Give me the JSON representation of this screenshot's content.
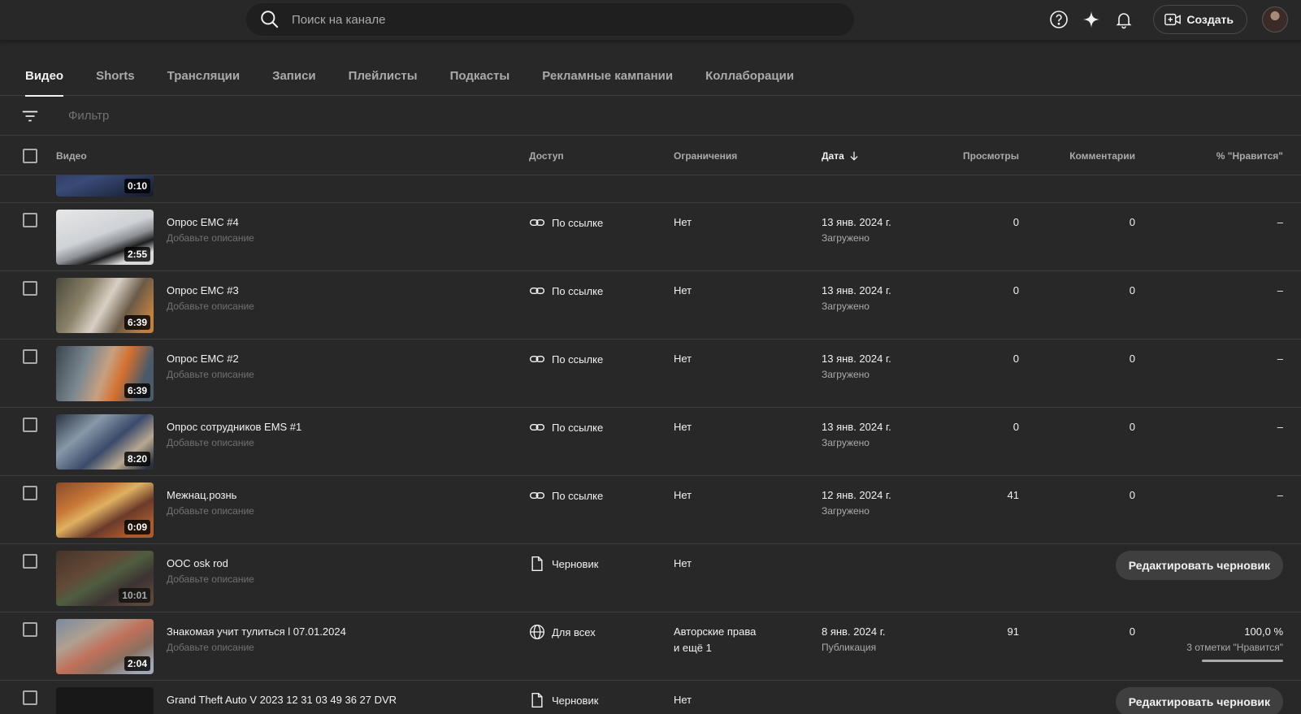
{
  "search": {
    "placeholder": "Поиск на канале"
  },
  "topbar": {
    "create_label": "Создать"
  },
  "tabs": [
    {
      "label": "Видео",
      "active": true
    },
    {
      "label": "Shorts"
    },
    {
      "label": "Трансляции"
    },
    {
      "label": "Записи"
    },
    {
      "label": "Плейлисты"
    },
    {
      "label": "Подкасты"
    },
    {
      "label": "Рекламные кампании"
    },
    {
      "label": "Коллаборации"
    }
  ],
  "filter": {
    "placeholder": "Фильтр"
  },
  "columns": {
    "video": "Видео",
    "visibility": "Доступ",
    "restrictions": "Ограничения",
    "date": "Дата",
    "views": "Просмотры",
    "comments": "Комментарии",
    "likes": "% \"Нравится\""
  },
  "partial_row": {
    "duration": "0:10"
  },
  "rows": [
    {
      "title": "Опрос EMC #4",
      "description": "Добавьте описание",
      "duration": "2:55",
      "visibility": "По ссылке",
      "visibility_icon": "link-icon",
      "restrictions": "Нет",
      "restrictions_2": "",
      "date": "13 янв. 2024 г.",
      "status": "Загружено",
      "views": "0",
      "comments": "0",
      "likes": "–",
      "likes_sub": "",
      "draft_label": ""
    },
    {
      "title": "Опрос EMC #3",
      "description": "Добавьте описание",
      "duration": "6:39",
      "visibility": "По ссылке",
      "visibility_icon": "link-icon",
      "restrictions": "Нет",
      "restrictions_2": "",
      "date": "13 янв. 2024 г.",
      "status": "Загружено",
      "views": "0",
      "comments": "0",
      "likes": "–",
      "likes_sub": "",
      "draft_label": ""
    },
    {
      "title": "Опрос EMC #2",
      "description": "Добавьте описание",
      "duration": "6:39",
      "visibility": "По ссылке",
      "visibility_icon": "link-icon",
      "restrictions": "Нет",
      "restrictions_2": "",
      "date": "13 янв. 2024 г.",
      "status": "Загружено",
      "views": "0",
      "comments": "0",
      "likes": "–",
      "likes_sub": "",
      "draft_label": ""
    },
    {
      "title": "Опрос сотрудников EMS #1",
      "description": "Добавьте описание",
      "duration": "8:20",
      "visibility": "По ссылке",
      "visibility_icon": "link-icon",
      "restrictions": "Нет",
      "restrictions_2": "",
      "date": "13 янв. 2024 г.",
      "status": "Загружено",
      "views": "0",
      "comments": "0",
      "likes": "–",
      "likes_sub": "",
      "draft_label": ""
    },
    {
      "title": "Межнац.рознь",
      "description": "Добавьте описание",
      "duration": "0:09",
      "visibility": "По ссылке",
      "visibility_icon": "link-icon",
      "restrictions": "Нет",
      "restrictions_2": "",
      "date": "12 янв. 2024 г.",
      "status": "Загружено",
      "views": "41",
      "comments": "0",
      "likes": "–",
      "likes_sub": "",
      "draft_label": ""
    },
    {
      "title": "OOC osk rod",
      "description": "Добавьте описание",
      "duration": "10:01",
      "visibility": "Черновик",
      "visibility_icon": "draft-icon",
      "restrictions": "Нет",
      "restrictions_2": "",
      "date": "",
      "status": "",
      "views": "",
      "comments": "",
      "likes": "",
      "likes_sub": "",
      "draft_label": "Редактировать черновик"
    },
    {
      "title": "Знакомая учит тулиться l 07.01.2024",
      "description": "Добавьте описание",
      "duration": "2:04",
      "visibility": "Для всех",
      "visibility_icon": "globe-icon",
      "restrictions": "Авторские права",
      "restrictions_2": "и ещё 1",
      "date": "8 янв. 2024 г.",
      "status": "Публикация",
      "views": "91",
      "comments": "0",
      "likes": "100,0 %",
      "likes_sub": "3 отметки \"Нравится\"",
      "like_ratio": 1.0,
      "draft_label": ""
    },
    {
      "title": "Grand Theft Auto V 2023 12 31 03 49 36 27 DVR",
      "description": "",
      "duration": "",
      "visibility": "Черновик",
      "visibility_icon": "draft-icon",
      "restrictions": "Нет",
      "restrictions_2": "",
      "date": "",
      "status": "",
      "views": "",
      "comments": "",
      "likes": "",
      "likes_sub": "",
      "draft_label": "Редактировать черновик"
    }
  ],
  "colors": {
    "background": "#282828",
    "divider": "#3e3e3e",
    "text_primary": "#f1f1f1",
    "text_secondary": "#aaaaaa",
    "text_muted": "#717171",
    "button_bg": "#3f3f3f"
  }
}
